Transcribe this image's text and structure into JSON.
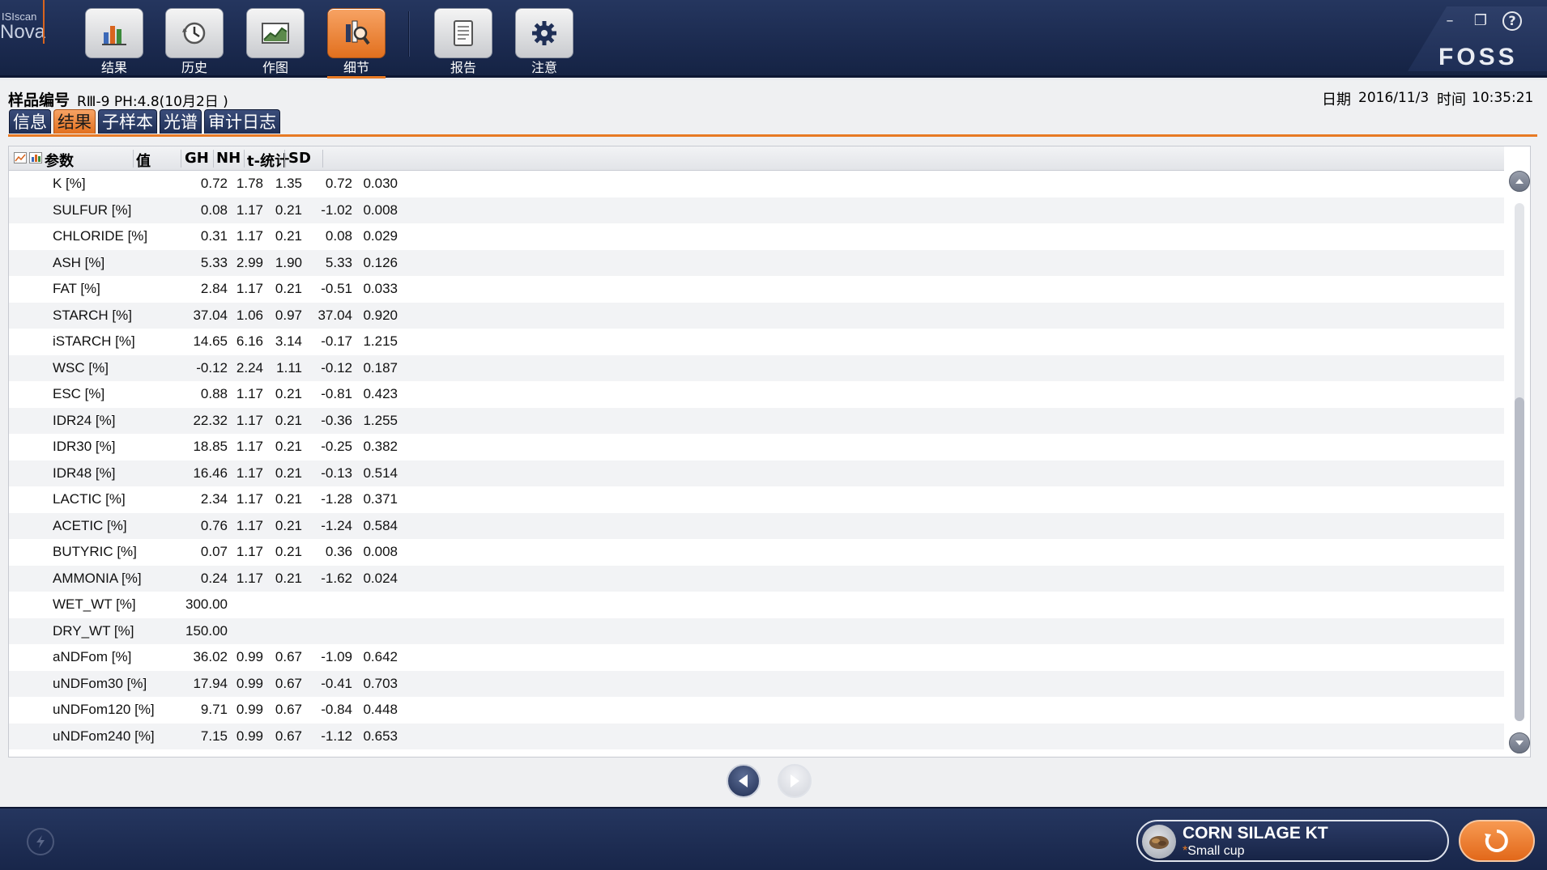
{
  "app": {
    "logo_top": "ISIscan",
    "logo_bottom": "Nova",
    "brand": "FOSS"
  },
  "toolbar": [
    {
      "label": "结果",
      "icon": "bar-chart-icon"
    },
    {
      "label": "历史",
      "icon": "history-clock-icon"
    },
    {
      "label": "作图",
      "icon": "plot-icon"
    },
    {
      "label": "细节",
      "icon": "detail-magnifier-icon",
      "active": true
    },
    {
      "label": "报告",
      "icon": "report-icon"
    },
    {
      "label": "注意",
      "icon": "settings-gear-icon"
    }
  ],
  "window_controls": {
    "minimize": "–",
    "restore": "❐",
    "help": "?"
  },
  "sample": {
    "label": "样品编号",
    "value": "RⅢ-9 PH:4.8(10月2日 )"
  },
  "datetime": {
    "date_label": "日期",
    "date": "2016/11/3",
    "time_label": "时间",
    "time": "10:35:21"
  },
  "tabs": [
    {
      "label": "信息"
    },
    {
      "label": "结果",
      "active": true
    },
    {
      "label": "子样本"
    },
    {
      "label": "光谱"
    },
    {
      "label": "审计日志"
    }
  ],
  "table": {
    "headers": {
      "param": "参数",
      "value": "值",
      "gh": "GH",
      "nh": "NH",
      "t": "t-统计",
      "sd": "SD"
    },
    "rows": [
      {
        "param": "K [%]",
        "value": "0.72",
        "gh": "1.78",
        "nh": "1.35",
        "t": "0.72",
        "sd": "0.030"
      },
      {
        "param": "SULFUR [%]",
        "value": "0.08",
        "gh": "1.17",
        "nh": "0.21",
        "t": "-1.02",
        "sd": "0.008"
      },
      {
        "param": "CHLORIDE [%]",
        "value": "0.31",
        "gh": "1.17",
        "nh": "0.21",
        "t": "0.08",
        "sd": "0.029"
      },
      {
        "param": "ASH [%]",
        "value": "5.33",
        "gh": "2.99",
        "nh": "1.90",
        "t": "5.33",
        "sd": "0.126"
      },
      {
        "param": "FAT [%]",
        "value": "2.84",
        "gh": "1.17",
        "nh": "0.21",
        "t": "-0.51",
        "sd": "0.033"
      },
      {
        "param": "STARCH [%]",
        "value": "37.04",
        "gh": "1.06",
        "nh": "0.97",
        "t": "37.04",
        "sd": "0.920"
      },
      {
        "param": "iSTARCH [%]",
        "value": "14.65",
        "gh": "6.16",
        "nh": "3.14",
        "t": "-0.17",
        "sd": "1.215"
      },
      {
        "param": "WSC [%]",
        "value": "-0.12",
        "gh": "2.24",
        "nh": "1.11",
        "t": "-0.12",
        "sd": "0.187"
      },
      {
        "param": "ESC [%]",
        "value": "0.88",
        "gh": "1.17",
        "nh": "0.21",
        "t": "-0.81",
        "sd": "0.423"
      },
      {
        "param": "IDR24 [%]",
        "value": "22.32",
        "gh": "1.17",
        "nh": "0.21",
        "t": "-0.36",
        "sd": "1.255"
      },
      {
        "param": "IDR30 [%]",
        "value": "18.85",
        "gh": "1.17",
        "nh": "0.21",
        "t": "-0.25",
        "sd": "0.382"
      },
      {
        "param": "IDR48 [%]",
        "value": "16.46",
        "gh": "1.17",
        "nh": "0.21",
        "t": "-0.13",
        "sd": "0.514"
      },
      {
        "param": "LACTIC [%]",
        "value": "2.34",
        "gh": "1.17",
        "nh": "0.21",
        "t": "-1.28",
        "sd": "0.371"
      },
      {
        "param": "ACETIC [%]",
        "value": "0.76",
        "gh": "1.17",
        "nh": "0.21",
        "t": "-1.24",
        "sd": "0.584"
      },
      {
        "param": "BUTYRIC [%]",
        "value": "0.07",
        "gh": "1.17",
        "nh": "0.21",
        "t": "0.36",
        "sd": "0.008"
      },
      {
        "param": "AMMONIA [%]",
        "value": "0.24",
        "gh": "1.17",
        "nh": "0.21",
        "t": "-1.62",
        "sd": "0.024"
      },
      {
        "param": "WET_WT [%]",
        "value": "300.00",
        "gh": "",
        "nh": "",
        "t": "",
        "sd": ""
      },
      {
        "param": "DRY_WT [%]",
        "value": "150.00",
        "gh": "",
        "nh": "",
        "t": "",
        "sd": ""
      },
      {
        "param": "aNDFom [%]",
        "value": "36.02",
        "gh": "0.99",
        "nh": "0.67",
        "t": "-1.09",
        "sd": "0.642"
      },
      {
        "param": "uNDFom30 [%]",
        "value": "17.94",
        "gh": "0.99",
        "nh": "0.67",
        "t": "-0.41",
        "sd": "0.703"
      },
      {
        "param": "uNDFom120 [%]",
        "value": "9.71",
        "gh": "0.99",
        "nh": "0.67",
        "t": "-0.84",
        "sd": "0.448"
      },
      {
        "param": "uNDFom240 [%]",
        "value": "7.15",
        "gh": "0.99",
        "nh": "0.67",
        "t": "-1.12",
        "sd": "0.653"
      }
    ]
  },
  "product": {
    "name": "CORN SILAGE KT",
    "cup_marker": "*",
    "cup": "Small cup"
  },
  "colors": {
    "accent": "#e87a24",
    "navy": "#1f2f56",
    "row_alt": "#f2f3f5"
  }
}
